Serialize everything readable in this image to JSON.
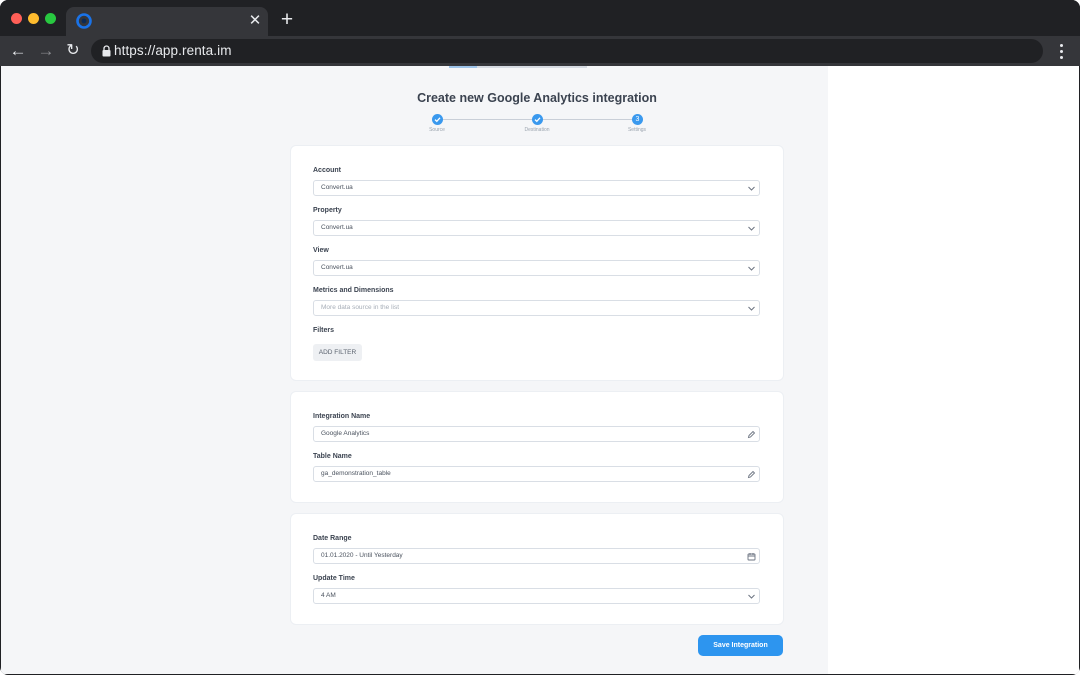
{
  "browser": {
    "url": "https://app.renta.im",
    "tab": {
      "favicon": "renta-logo-icon"
    },
    "colors": {
      "frame": "#202124",
      "toolbar": "#35363a"
    }
  },
  "page": {
    "title": "Create new Google Analytics integration",
    "accent_color": "#2d95ef",
    "steps": [
      {
        "label": "Source",
        "state": "done"
      },
      {
        "label": "Destination",
        "state": "done"
      },
      {
        "label": "Settings",
        "state": "current",
        "number": "3"
      }
    ]
  },
  "source_card": {
    "account": {
      "label": "Account",
      "value": "Convert.ua"
    },
    "property": {
      "label": "Property",
      "value": "Convert.ua"
    },
    "view": {
      "label": "View",
      "value": "Convert.ua"
    },
    "metrics": {
      "label": "Metrics and Dimensions",
      "placeholder": "More data source in the list"
    },
    "filters": {
      "label": "Filters",
      "button": "ADD FILTER"
    }
  },
  "naming_card": {
    "integration_name": {
      "label": "Integration Name",
      "value": "Google Analytics"
    },
    "table_name": {
      "label": "Table Name",
      "value": "ga_demonstration_table"
    }
  },
  "schedule_card": {
    "date_range": {
      "label": "Date Range",
      "value": "01.01.2020 - Until Yesterday"
    },
    "update_time": {
      "label": "Update Time",
      "value": "4 AM"
    }
  },
  "actions": {
    "save": "Save Integration"
  }
}
